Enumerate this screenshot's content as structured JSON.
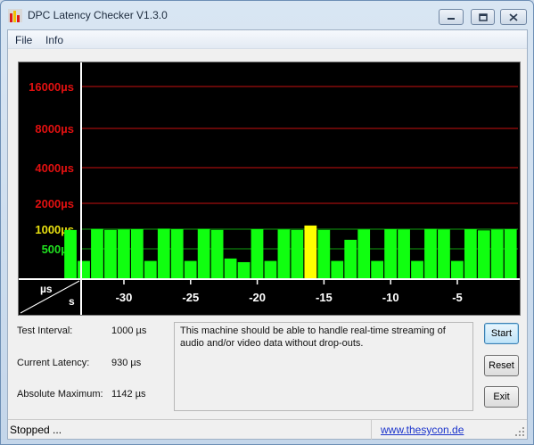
{
  "window": {
    "title": "DPC Latency Checker V1.3.0"
  },
  "menu": [
    "File",
    "Info"
  ],
  "chart_data": {
    "type": "bar",
    "y_scale_labels": [
      {
        "text": "16000µs",
        "value": 16000,
        "color": "#e01010"
      },
      {
        "text": "8000µs",
        "value": 8000,
        "color": "#e01010"
      },
      {
        "text": "4000µs",
        "value": 4000,
        "color": "#e01010"
      },
      {
        "text": "2000µs",
        "value": 2000,
        "color": "#e01010"
      },
      {
        "text": "1000µs",
        "value": 1000,
        "color": "#e8e010"
      },
      {
        "text": "500µs",
        "value": 500,
        "color": "#20e020"
      }
    ],
    "x_tick_labels": [
      "-30",
      "-25",
      "-20",
      "-15",
      "-10",
      "-5"
    ],
    "x_ticks": [
      -30,
      -25,
      -20,
      -15,
      -10,
      -5
    ],
    "corner_labels": {
      "y_unit": "µs",
      "x_unit": "s"
    },
    "series": [
      {
        "x": [
          -34,
          -33,
          -32,
          -31,
          -30,
          -29,
          -28,
          -27,
          -26,
          -25,
          -24,
          -23,
          -22,
          -21,
          -20,
          -19,
          -18,
          -17,
          -16,
          -15,
          -14,
          -13,
          -12,
          -11,
          -10,
          -9,
          -8,
          -7,
          -6,
          -5,
          -4,
          -3,
          -2,
          -1
        ],
        "values": [
          980,
          300,
          1010,
          980,
          990,
          1000,
          300,
          1020,
          1000,
          300,
          1010,
          980,
          340,
          280,
          1000,
          300,
          990,
          980,
          1142,
          980,
          300,
          730,
          990,
          300,
          1000,
          990,
          300,
          1010,
          990,
          300,
          1000,
          970,
          990,
          1000
        ],
        "highlight_index": 18
      }
    ],
    "colors": {
      "bar": "#10ff10",
      "highlight": "#ffff00",
      "grid_red": "#c81010",
      "grid_green": "#10a010",
      "axis": "#ffffff"
    }
  },
  "info": {
    "test_interval_label": "Test Interval:",
    "test_interval_value": "1000 µs",
    "current_latency_label": "Current Latency:",
    "current_latency_value": "930 µs",
    "absolute_maximum_label": "Absolute Maximum:",
    "absolute_maximum_value": "1142 µs"
  },
  "message": "This machine should be able to handle real-time streaming of audio and/or video data without drop-outs.",
  "buttons": {
    "start": "Start",
    "reset": "Reset",
    "exit": "Exit"
  },
  "status": {
    "text": "Stopped ...",
    "link": "www.thesycon.de"
  }
}
